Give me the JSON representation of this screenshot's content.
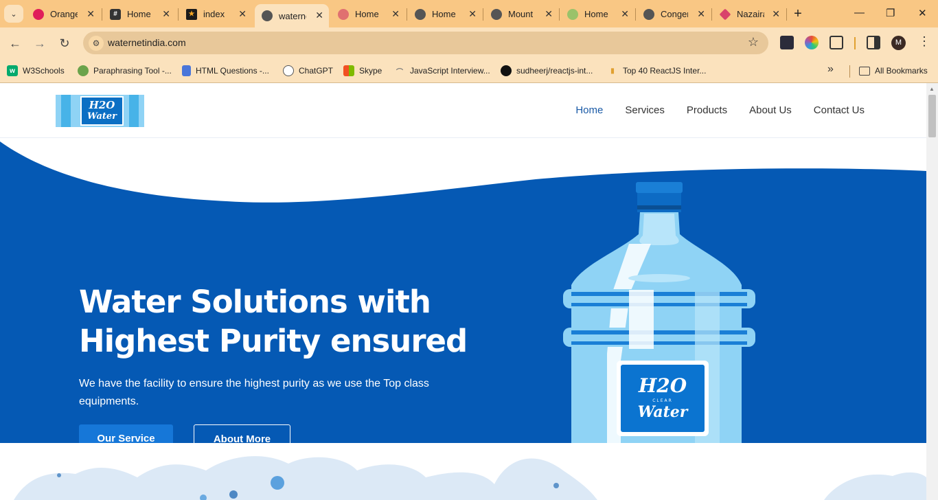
{
  "browser": {
    "tabs": [
      {
        "title": "Orange",
        "favicon": "slack-icon",
        "color": "#e01e5a"
      },
      {
        "title": "Home",
        "favicon": "grid-icon",
        "color": "#333333"
      },
      {
        "title": "index",
        "favicon": "star-icon",
        "color": "#1a1a1a"
      },
      {
        "title": "waterne",
        "favicon": "globe-icon",
        "color": "#555555",
        "active": true
      },
      {
        "title": "Home",
        "favicon": "tent-icon",
        "color": "#e07070"
      },
      {
        "title": "Home",
        "favicon": "globe-icon",
        "color": "#555555"
      },
      {
        "title": "Mount",
        "favicon": "globe-icon",
        "color": "#555555"
      },
      {
        "title": "Home",
        "favicon": "leaf-icon",
        "color": "#9ac26a"
      },
      {
        "title": "Conger",
        "favicon": "globe-icon",
        "color": "#555555"
      },
      {
        "title": "Nazaira",
        "favicon": "diamond-icon",
        "color": "#d9436b"
      }
    ],
    "close_glyph": "✕",
    "new_tab_glyph": "+",
    "url": "waternetindia.com",
    "profile_initial": "M",
    "bookmarks": [
      {
        "label": "W3Schools",
        "icon": "w3schools-icon",
        "color": "#04aa6d"
      },
      {
        "label": "Paraphrasing Tool -...",
        "icon": "robot-icon",
        "color": "#6ba34b"
      },
      {
        "label": "HTML Questions -...",
        "icon": "doc-icon",
        "color": "#4a76d9"
      },
      {
        "label": "ChatGPT",
        "icon": "chatgpt-icon",
        "color": "#555555"
      },
      {
        "label": "Skype",
        "icon": "windows-icon",
        "color": "#f25022"
      },
      {
        "label": "JavaScript Interview...",
        "icon": "bridge-icon",
        "color": "#777777"
      },
      {
        "label": "sudheerj/reactjs-int...",
        "icon": "github-icon",
        "color": "#111111"
      },
      {
        "label": "Top 40 ReactJS Inter...",
        "icon": "bookmark-icon",
        "color": "#e0a030"
      }
    ],
    "all_bookmarks": "All Bookmarks"
  },
  "site": {
    "logo": {
      "line1": "H2O",
      "line2": "Water"
    },
    "nav": [
      {
        "label": "Home",
        "active": true
      },
      {
        "label": "Services"
      },
      {
        "label": "Products"
      },
      {
        "label": "About Us"
      },
      {
        "label": "Contact Us"
      }
    ],
    "hero": {
      "title": "Water Solutions with Highest Purity ensured",
      "subtitle": "We have the facility to ensure the highest purity as we use the Top class equipments.",
      "primary_button": "Our Service",
      "secondary_button": "About More"
    },
    "bottle_label": {
      "line1": "H2O",
      "small": "CLEAR",
      "line2": "Water"
    }
  },
  "colors": {
    "chrome": "#f9c784",
    "hero_blue": "#0559b4",
    "accent": "#1677d8"
  }
}
